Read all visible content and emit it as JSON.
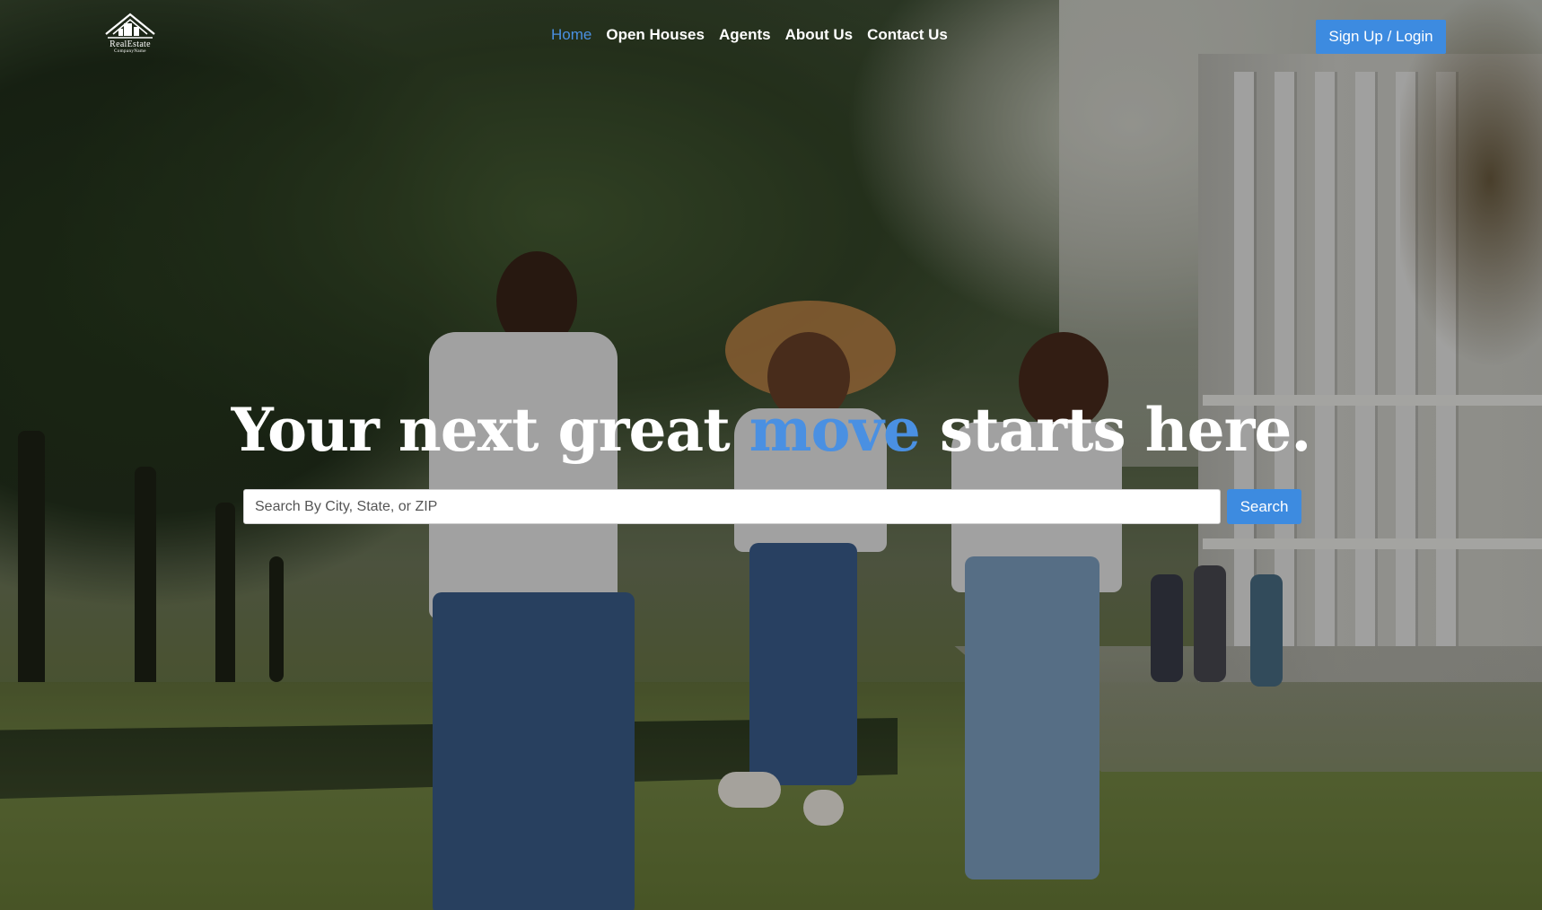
{
  "brand": {
    "logo_icon": "house-roof-icon",
    "name": "RealEstate",
    "sub": "CompanyName"
  },
  "nav": {
    "items": [
      {
        "label": "Home",
        "active": true
      },
      {
        "label": "Open Houses",
        "active": false
      },
      {
        "label": "Agents",
        "active": false
      },
      {
        "label": "About Us",
        "active": false
      },
      {
        "label": "Contact Us",
        "active": false
      }
    ],
    "signup_label": "Sign Up / Login"
  },
  "hero": {
    "headline_before": "Your next great",
    "headline_accent": "move",
    "headline_after": "starts here.",
    "search_placeholder": "Search By City, State, or ZIP",
    "search_value": "",
    "search_button": "Search"
  },
  "colors": {
    "accent": "#4a90e2",
    "button": "#3d8be0",
    "text": "#ffffff"
  }
}
